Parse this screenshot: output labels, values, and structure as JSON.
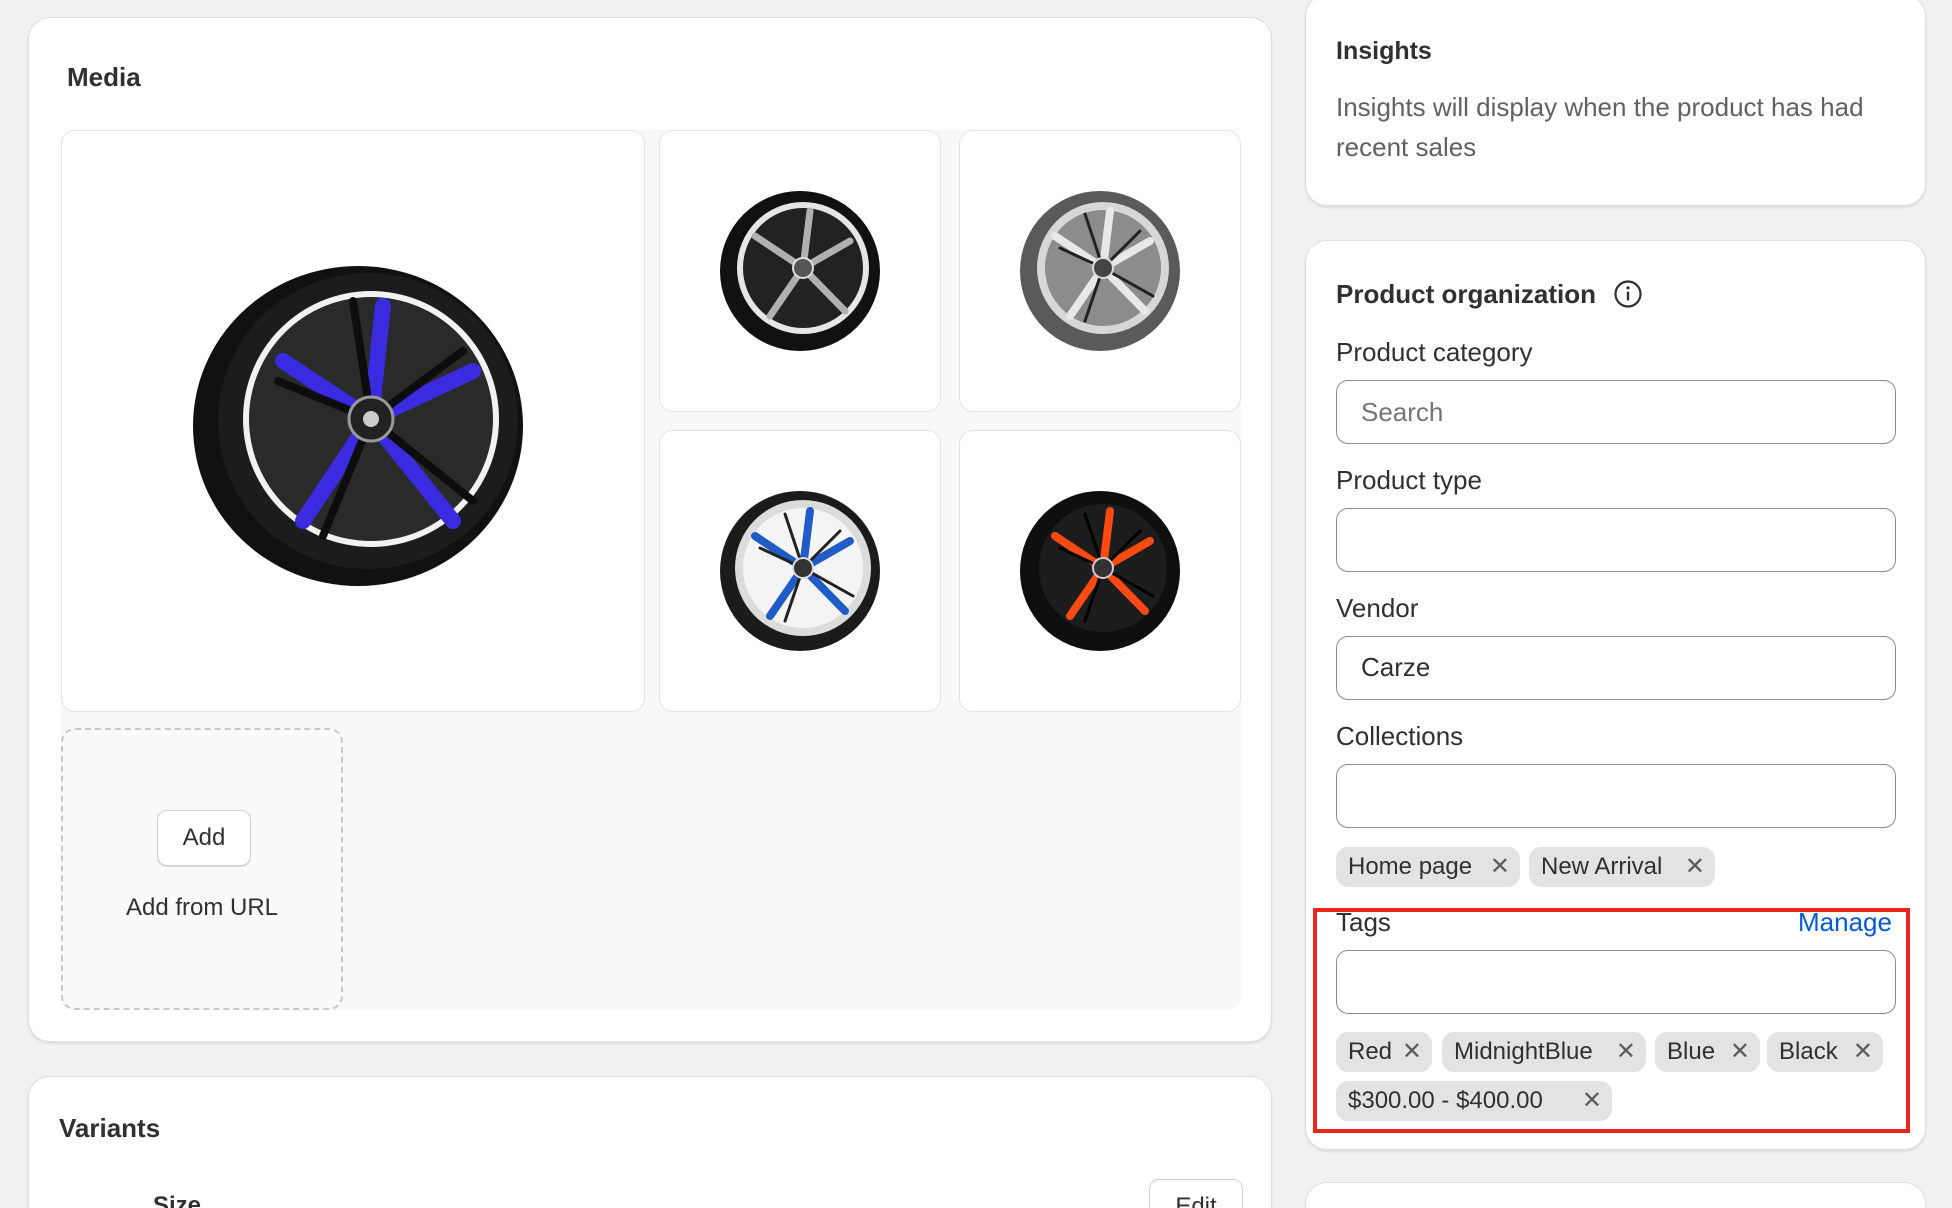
{
  "media": {
    "title": "Media",
    "images": [
      {
        "name": "wheel-main",
        "accent": "#3b2be0"
      },
      {
        "name": "wheel-black",
        "accent": "#9c9c9c"
      },
      {
        "name": "wheel-chrome",
        "accent": "#bdbdbd"
      },
      {
        "name": "wheel-blue",
        "accent": "#1f5cc7"
      },
      {
        "name": "wheel-red",
        "accent": "#ff4a12"
      }
    ],
    "add_label": "Add",
    "add_from_url_label": "Add from URL"
  },
  "variants": {
    "title": "Variants",
    "size_label": "Size",
    "edit_label": "Edit"
  },
  "insights": {
    "title": "Insights",
    "text": "Insights will display when the product has had recent sales"
  },
  "organization": {
    "title": "Product organization",
    "info_icon": "info-icon",
    "category": {
      "label": "Product category",
      "placeholder": "Search",
      "value": ""
    },
    "type": {
      "label": "Product type",
      "value": ""
    },
    "vendor": {
      "label": "Vendor",
      "value": "Carze"
    },
    "collections": {
      "label": "Collections",
      "value": "",
      "chips": [
        "Home page",
        "New Arrival"
      ]
    },
    "tags": {
      "label": "Tags",
      "manage_label": "Manage",
      "value": "",
      "chips": [
        "Red",
        "MidnightBlue",
        "Blue",
        "Black",
        "$300.00 - $400.00"
      ]
    }
  },
  "colors": {
    "accent_link": "#005bd3",
    "highlight": "#e8261c",
    "chip_bg": "#e3e3e3"
  }
}
